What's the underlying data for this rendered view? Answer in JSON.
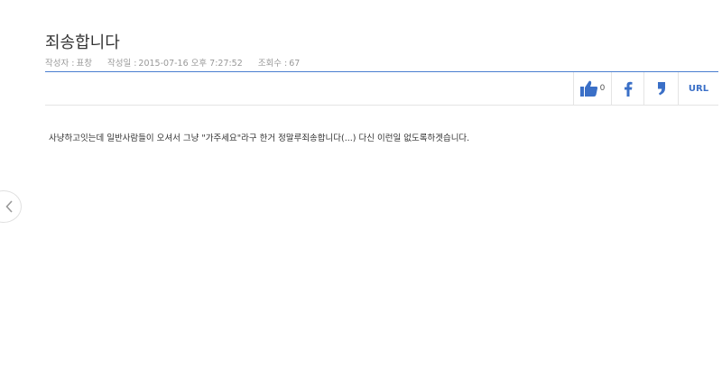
{
  "post": {
    "title": "죄송합니다",
    "meta": {
      "author_label": "작성자 :",
      "author": "표창",
      "date_label": "작성일 :",
      "date": "2015-07-16 오후 7:27:52",
      "views_label": "조회수 :",
      "views": "67"
    },
    "body": "사냥하고잇는데 일반사람들이 오셔서 그냥 \"가주세요\"라구 한거 정말루죄송합니다(...) 다신 이런일 없도록하겟습니다."
  },
  "toolbar": {
    "like_count": "0",
    "url_label": "URL"
  },
  "colors": {
    "accent": "#4a7fd0",
    "icon_blue": "#3a6fc7"
  },
  "icons": {
    "like": "thumbs-up-icon",
    "facebook": "facebook-icon",
    "quote": "quote-icon",
    "prev": "chevron-left-icon"
  }
}
